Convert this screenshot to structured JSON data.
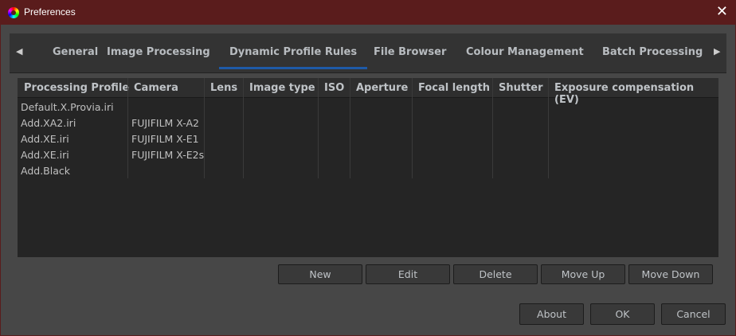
{
  "window": {
    "title": "Preferences"
  },
  "tabs": [
    "General",
    "Image Processing",
    "Dynamic Profile Rules",
    "File Browser",
    "Colour Management",
    "Batch Processing"
  ],
  "active_tab": "Dynamic Profile Rules",
  "table": {
    "columns": [
      "Processing Profile",
      "Camera",
      "Lens",
      "Image type",
      "ISO",
      "Aperture",
      "Focal length",
      "Shutter",
      "Exposure compensation (EV)"
    ],
    "rows": [
      {
        "profile": "Default.X.Provia.iri",
        "camera": ""
      },
      {
        "profile": "Add.XA2.iri",
        "camera": "FUJIFILM X-A2"
      },
      {
        "profile": "Add.XE.iri",
        "camera": "FUJIFILM X-E1"
      },
      {
        "profile": "Add.XE.iri",
        "camera": "FUJIFILM X-E2s"
      },
      {
        "profile": "Add.Black",
        "camera": ""
      }
    ]
  },
  "rule_buttons": {
    "new": "New",
    "edit": "Edit",
    "delete": "Delete",
    "move_up": "Move Up",
    "move_down": "Move Down"
  },
  "dialog_buttons": {
    "about": "About",
    "ok": "OK",
    "cancel": "Cancel"
  },
  "colors": {
    "titlebar": "#5a1c1c",
    "active_tab_underline": "#1e5aa8"
  }
}
